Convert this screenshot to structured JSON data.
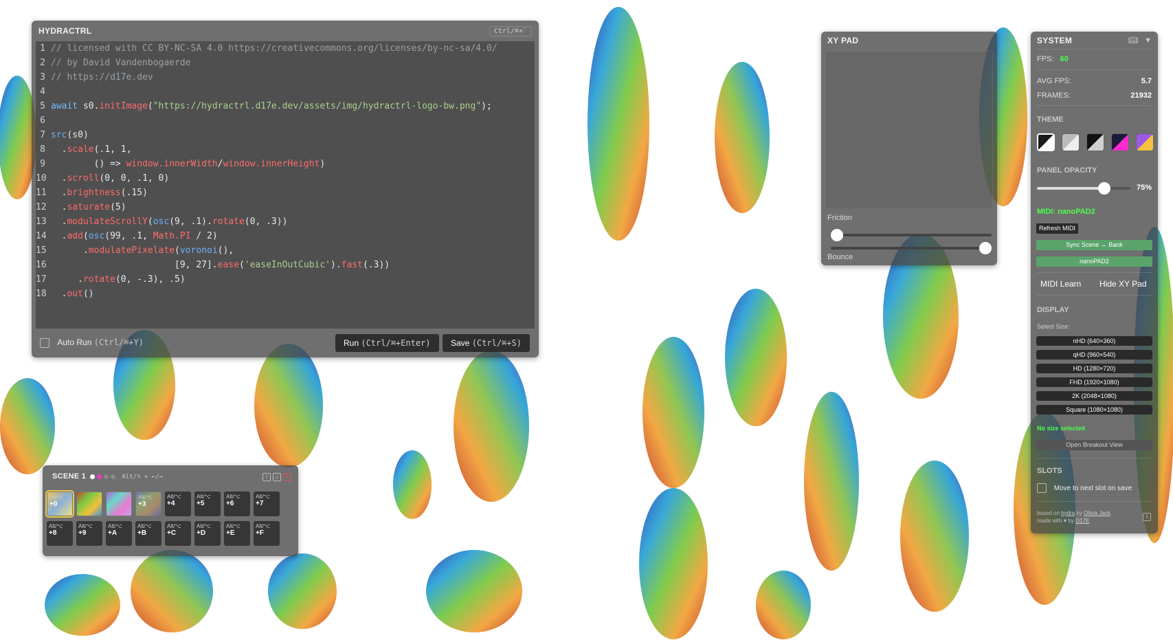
{
  "colors": {
    "accent_green": "#5aa36a",
    "fps_green": "#4cff4c",
    "scene_active_dot": "#e83ec8"
  },
  "editor": {
    "title": "HYDRACTRL",
    "shortcut": "Ctrl/⌘+`",
    "code_lines": [
      "// licensed with CC BY-NC-SA 4.0 https://creativecommons.org/licenses/by-nc-sa/4.0/",
      "// by David Vandenbogaerde",
      "// https://d17e.dev",
      "",
      "await s0.initImage(\"https://hydractrl.d17e.dev/assets/img/hydractrl-logo-bw.png\");",
      "",
      "src(s0)",
      "  .scale(.1, 1,",
      "        () => window.innerWidth/window.innerHeight)",
      "  .scroll(0, 0, .1, 0)",
      "  .brightness(.15)",
      "  .saturate(5)",
      "  .modulateScrollY(osc(9, .1).rotate(0, .3))",
      "  .add(osc(99, .1, Math.PI / 2)",
      "      .modulatePixelate(voronoi(),",
      "                       [9, 27].ease('easeInOutCubic').fast(.3))",
      "     .rotate(0, -.3), .5)",
      "  .out()"
    ],
    "auto_run_label": "Auto Run",
    "auto_run_hint": "(Ctrl/⌘+Y)",
    "run_label": "Run",
    "run_hint": "(Ctrl/⌘+Enter)",
    "save_label": "Save",
    "save_hint": "(Ctrl/⌘+S)"
  },
  "scene": {
    "title": "SCENE 1",
    "hint": "Alt/⌥ + ←/→",
    "slots_row1": [
      {
        "mod": "Alt/⌥",
        "key": "+0",
        "thumb": true
      },
      {
        "mod": "",
        "key": "",
        "thumb": true
      },
      {
        "mod": "",
        "key": "",
        "thumb": true
      },
      {
        "mod": "Alt/⌥",
        "key": "+3",
        "thumb": true
      },
      {
        "mod": "Alt/⌥",
        "key": "+4",
        "thumb": false
      },
      {
        "mod": "Alt/⌥",
        "key": "+5",
        "thumb": false
      },
      {
        "mod": "Alt/⌥",
        "key": "+6",
        "thumb": false
      },
      {
        "mod": "Alt/⌥",
        "key": "+7",
        "thumb": false
      }
    ],
    "slots_row2": [
      {
        "mod": "Alt/⌥",
        "key": "+8"
      },
      {
        "mod": "Alt/⌥",
        "key": "+9"
      },
      {
        "mod": "Alt/⌥",
        "key": "+A"
      },
      {
        "mod": "Alt/⌥",
        "key": "+B"
      },
      {
        "mod": "Alt/⌥",
        "key": "+C"
      },
      {
        "mod": "Alt/⌥",
        "key": "+D"
      },
      {
        "mod": "Alt/⌥",
        "key": "+E"
      },
      {
        "mod": "Alt/⌥",
        "key": "+F"
      }
    ]
  },
  "xypad": {
    "title": "XY PAD",
    "friction_label": "Friction",
    "friction_value": 0.0,
    "bounce_label": "Bounce",
    "bounce_value": 1.0
  },
  "system": {
    "title": "SYSTEM",
    "fps_label": "FPS:",
    "fps_value": "60",
    "avg_fps_label": "AVG FPS:",
    "avg_fps_value": "5.7",
    "frames_label": "FRAMES:",
    "frames_value": "21932",
    "theme_label": "THEME",
    "panel_opacity_label": "PANEL OPACITY",
    "panel_opacity_value": "75%",
    "panel_opacity_fraction": 0.75,
    "midi_label": "MIDI: nanoPAD2",
    "refresh_midi": "Refresh MIDI",
    "sync_scene": "Sync Scene ↔ Bank",
    "device": "nanoPAD2",
    "midi_learn": "MIDI Learn",
    "hide_xy": "Hide XY Pad",
    "display_label": "DISPLAY",
    "select_size": "Select Size:",
    "sizes": [
      "nHD (640×360)",
      "qHD (960×540)",
      "HD (1280×720)",
      "FHD (1920×1080)",
      "2K (2048×1080)",
      "Square (1080×1080)"
    ],
    "no_size": "No size selected",
    "breakout": "Open Breakout View",
    "slots_label": "SLOTS",
    "move_next": "Move to next slot on save",
    "credits_line1": "based on",
    "credits_hydra": "hydra",
    "credits_by": "by",
    "credits_olivia": "Olivia Jack",
    "credits_line2": "made with ♥ by",
    "credits_d17e": "D17E"
  }
}
